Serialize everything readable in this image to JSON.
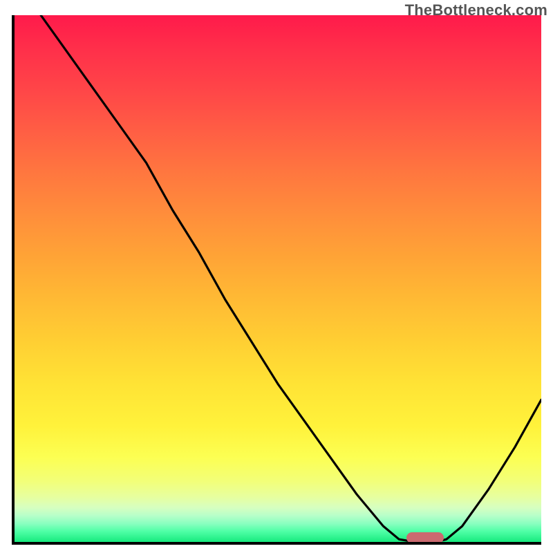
{
  "watermark": "TheBottleneck.com",
  "chart_data": {
    "type": "line",
    "title": "",
    "xlabel": "",
    "ylabel": "",
    "xlim": [
      0,
      100
    ],
    "ylim": [
      0,
      100
    ],
    "grid": false,
    "legend": false,
    "series": [
      {
        "name": "bottleneck-curve",
        "x": [
          5,
          10,
          15,
          20,
          25,
          30,
          35,
          40,
          45,
          50,
          55,
          60,
          65,
          70,
          73,
          76,
          80,
          82,
          85,
          90,
          95,
          100
        ],
        "values": [
          100,
          93,
          86,
          79,
          72,
          63,
          55,
          46,
          38,
          30,
          23,
          16,
          9,
          3,
          0.5,
          0,
          0,
          0.5,
          3,
          10,
          18,
          27
        ]
      }
    ],
    "background_gradient": {
      "direction": "vertical",
      "stops": [
        {
          "pos": 0.0,
          "color": "#ff1a4b"
        },
        {
          "pos": 0.3,
          "color": "#ff773f"
        },
        {
          "pos": 0.6,
          "color": "#ffcf33"
        },
        {
          "pos": 0.85,
          "color": "#fcff53"
        },
        {
          "pos": 1.0,
          "color": "#17ea7e"
        }
      ]
    },
    "marker": {
      "x": 78,
      "y": 0,
      "color": "#CB6A70",
      "shape": "pill"
    }
  }
}
